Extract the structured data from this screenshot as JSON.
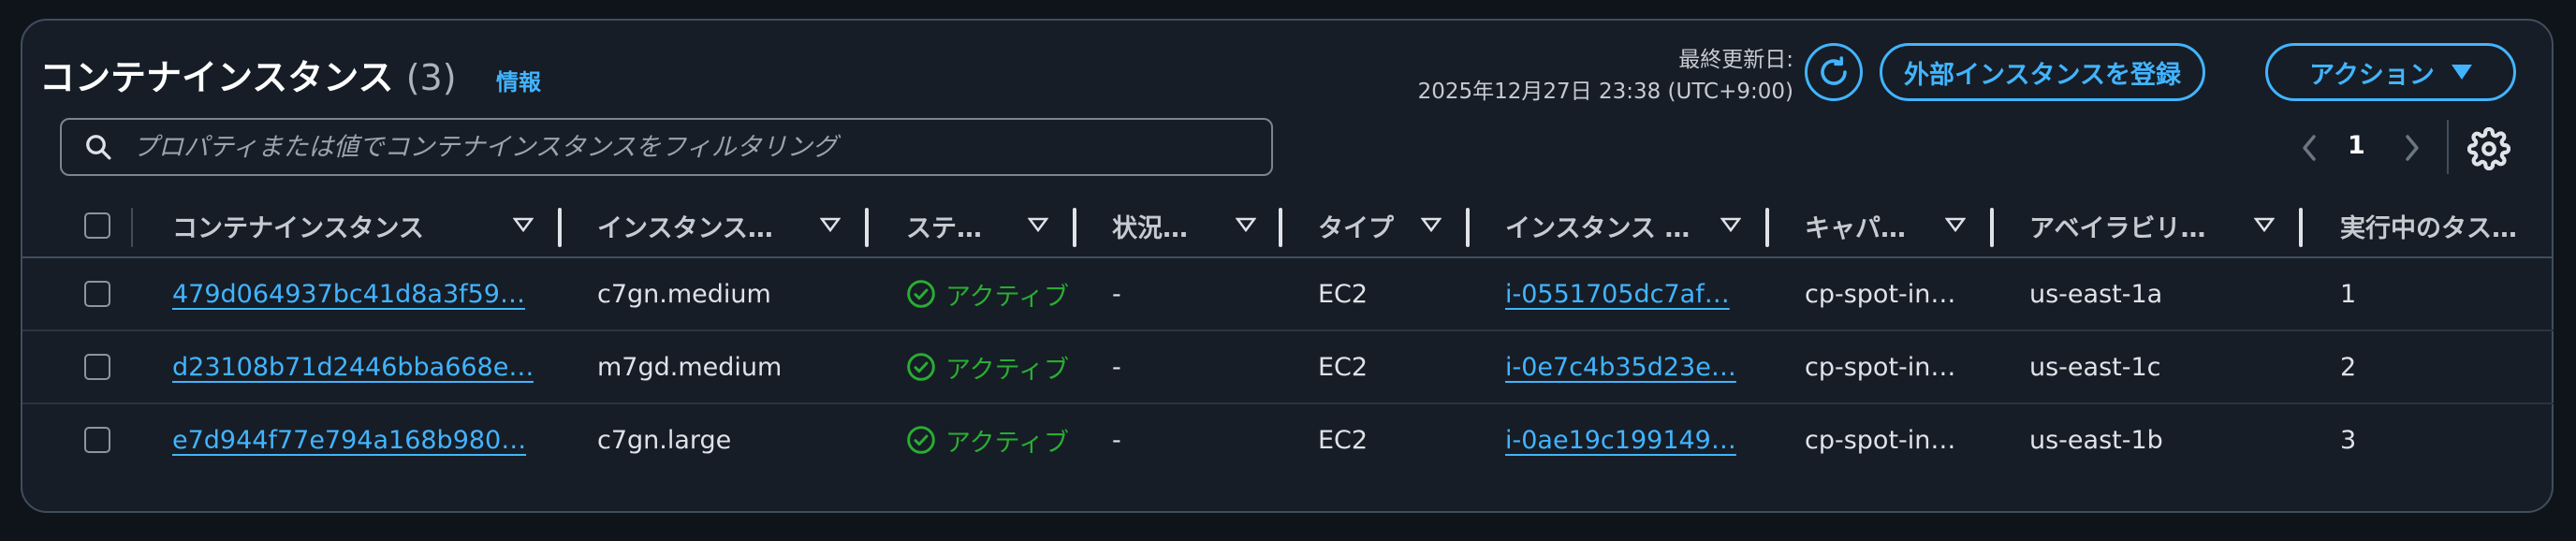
{
  "header": {
    "title": "コンテナインスタンス",
    "count": "(3)",
    "info_link": "情報",
    "updated_label": "最終更新日:",
    "updated_value": "2025年12月27日 23:38 (UTC+9:00)",
    "register_button": "外部インスタンスを登録",
    "actions_button": "アクション"
  },
  "search": {
    "placeholder": "プロパティまたは値でコンテナインスタンスをフィルタリング"
  },
  "pagination": {
    "current_page": "1"
  },
  "table": {
    "columns": [
      "コンテナインスタンス",
      "インスタンス…",
      "ステ…",
      "状況…",
      "タイプ",
      "インスタンス …",
      "キャパ…",
      "アベイラビリ…",
      "実行中のタス…"
    ],
    "rows": [
      {
        "container_instance": "479d064937bc41d8a3f59…",
        "instance_type": "c7gn.medium",
        "status": "アクティブ",
        "status_reason": "-",
        "type": "EC2",
        "instance_id": "i-0551705dc7af…",
        "capacity_provider": "cp-spot-in…",
        "availability_zone": "us-east-1a",
        "running_tasks": "1"
      },
      {
        "container_instance": "d23108b71d2446bba668e…",
        "instance_type": "m7gd.medium",
        "status": "アクティブ",
        "status_reason": "-",
        "type": "EC2",
        "instance_id": "i-0e7c4b35d23e…",
        "capacity_provider": "cp-spot-in…",
        "availability_zone": "us-east-1c",
        "running_tasks": "2"
      },
      {
        "container_instance": "e7d944f77e794a168b980…",
        "instance_type": "c7gn.large",
        "status": "アクティブ",
        "status_reason": "-",
        "type": "EC2",
        "instance_id": "i-0ae19c199149…",
        "capacity_provider": "cp-spot-in…",
        "availability_zone": "us-east-1b",
        "running_tasks": "3"
      }
    ]
  },
  "colors": {
    "background": "#0f141a",
    "panel": "#161d26",
    "accent": "#42b4ff",
    "success": "#29ad32"
  },
  "icons": {
    "refresh": "refresh-icon",
    "search": "search-icon",
    "dropdown": "caret-down-icon",
    "settings": "gear-icon",
    "status": "check-circle-icon",
    "sort": "sort-caret-icon"
  }
}
